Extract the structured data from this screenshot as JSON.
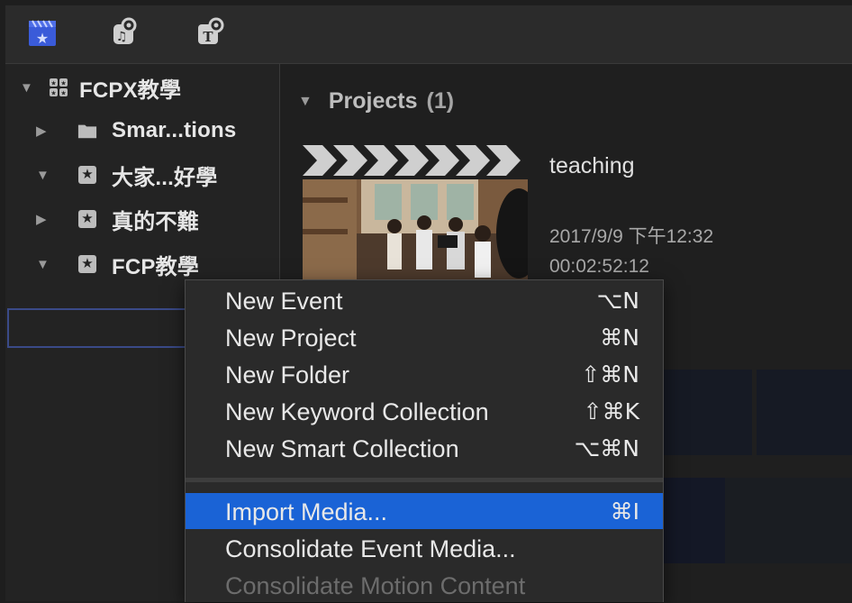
{
  "toolbar": {
    "icons": [
      "libraries-icon",
      "photos-audio-icon",
      "titles-generators-icon"
    ]
  },
  "sidebar": {
    "items": [
      {
        "label": "FCPX教學",
        "icon": "library-icon",
        "expanded": true
      },
      {
        "label": "Smar...tions",
        "icon": "folder-icon",
        "expanded": false
      },
      {
        "label": "大家...好學",
        "icon": "event-star-icon",
        "expanded": true
      },
      {
        "label": "真的不難",
        "icon": "event-star-icon",
        "expanded": false
      },
      {
        "label": "FCP教學",
        "icon": "event-star-icon",
        "expanded": true,
        "selected": true
      }
    ]
  },
  "browser": {
    "section_title": "Projects",
    "section_count": "(1)",
    "project": {
      "name": "teaching",
      "date": "2017/9/9 下午12:32",
      "duration": "00:02:52:12"
    }
  },
  "context_menu": {
    "groups": [
      [
        {
          "label": "New Event",
          "shortcut": "⌥N"
        },
        {
          "label": "New Project",
          "shortcut": "⌘N"
        },
        {
          "label": "New Folder",
          "shortcut": "⇧⌘N"
        },
        {
          "label": "New Keyword Collection",
          "shortcut": "⇧⌘K"
        },
        {
          "label": "New Smart Collection",
          "shortcut": "⌥⌘N"
        }
      ],
      [
        {
          "label": "Import Media...",
          "shortcut": "⌘I",
          "highlighted": true
        },
        {
          "label": "Consolidate Event Media...",
          "shortcut": ""
        },
        {
          "label": "Consolidate Motion Content",
          "shortcut": "",
          "disabled": true
        }
      ]
    ]
  },
  "colors": {
    "highlight": "#1a63d6",
    "selection_border": "#3a4a88",
    "toolbar_accent": "#3a5bd9"
  }
}
